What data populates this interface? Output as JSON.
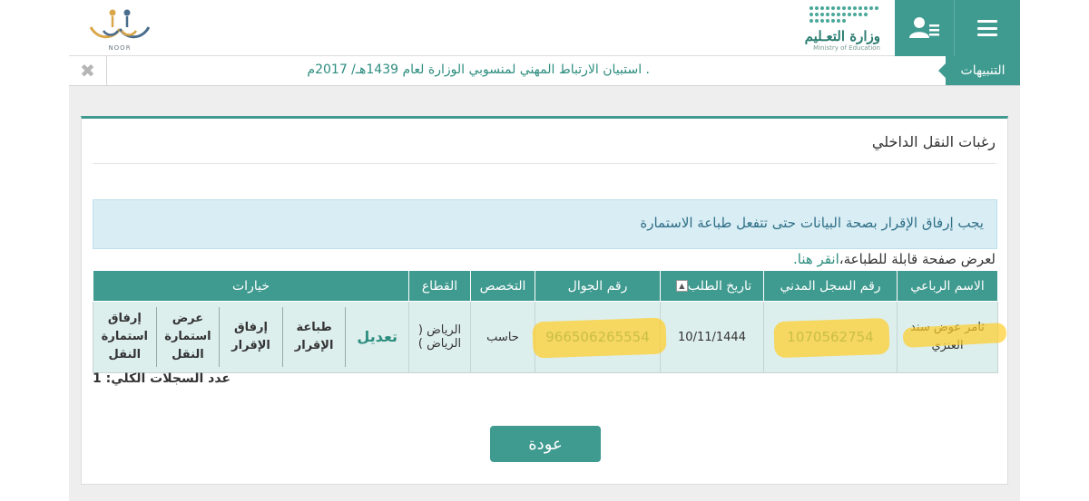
{
  "header": {
    "ministry_ar": "وزارة التعـليم",
    "ministry_en": "Ministry of Education",
    "noor_text": "NOOR"
  },
  "alerts": {
    "label": "التنبيهات",
    "text": ". استبيان الارتباط المهني لمنسوبي الوزارة لعام 1439هـ/ 2017م",
    "close": "✖"
  },
  "panel": {
    "title": "رغبات النقل الداخلي",
    "info": "يجب إرفاق الإقرار بصحة البيانات حتى تتفعل طباعة الاستمارة",
    "print_prefix": "لعرض صفحة قابلة للطباعة،",
    "print_link": "انقر هنا."
  },
  "table": {
    "headers": {
      "name": "الاسم الرباعي",
      "id": "رقم السجل المدني",
      "date": "تاريخ الطلب",
      "mobile": "رقم الجوال",
      "specialty": "التخصص",
      "sector": "القطاع",
      "options": "خيارات"
    },
    "row": {
      "name": "ثامر عوض سند العنزي",
      "id": "1070562754",
      "date": "10/11/1444",
      "mobile": "966506265554",
      "specialty": "حاسب",
      "sector": "الرياض ( الرياض )"
    },
    "actions": {
      "edit": "تعديل",
      "print_ack": "طباعة الإقرار",
      "attach_ack": "إرفاق الإقرار",
      "view_form": "عرض استمارة النقل",
      "attach_form": "إرفاق استمارة النقل"
    }
  },
  "total": "عدد السجلات الكلي: 1",
  "back_label": "عودة"
}
